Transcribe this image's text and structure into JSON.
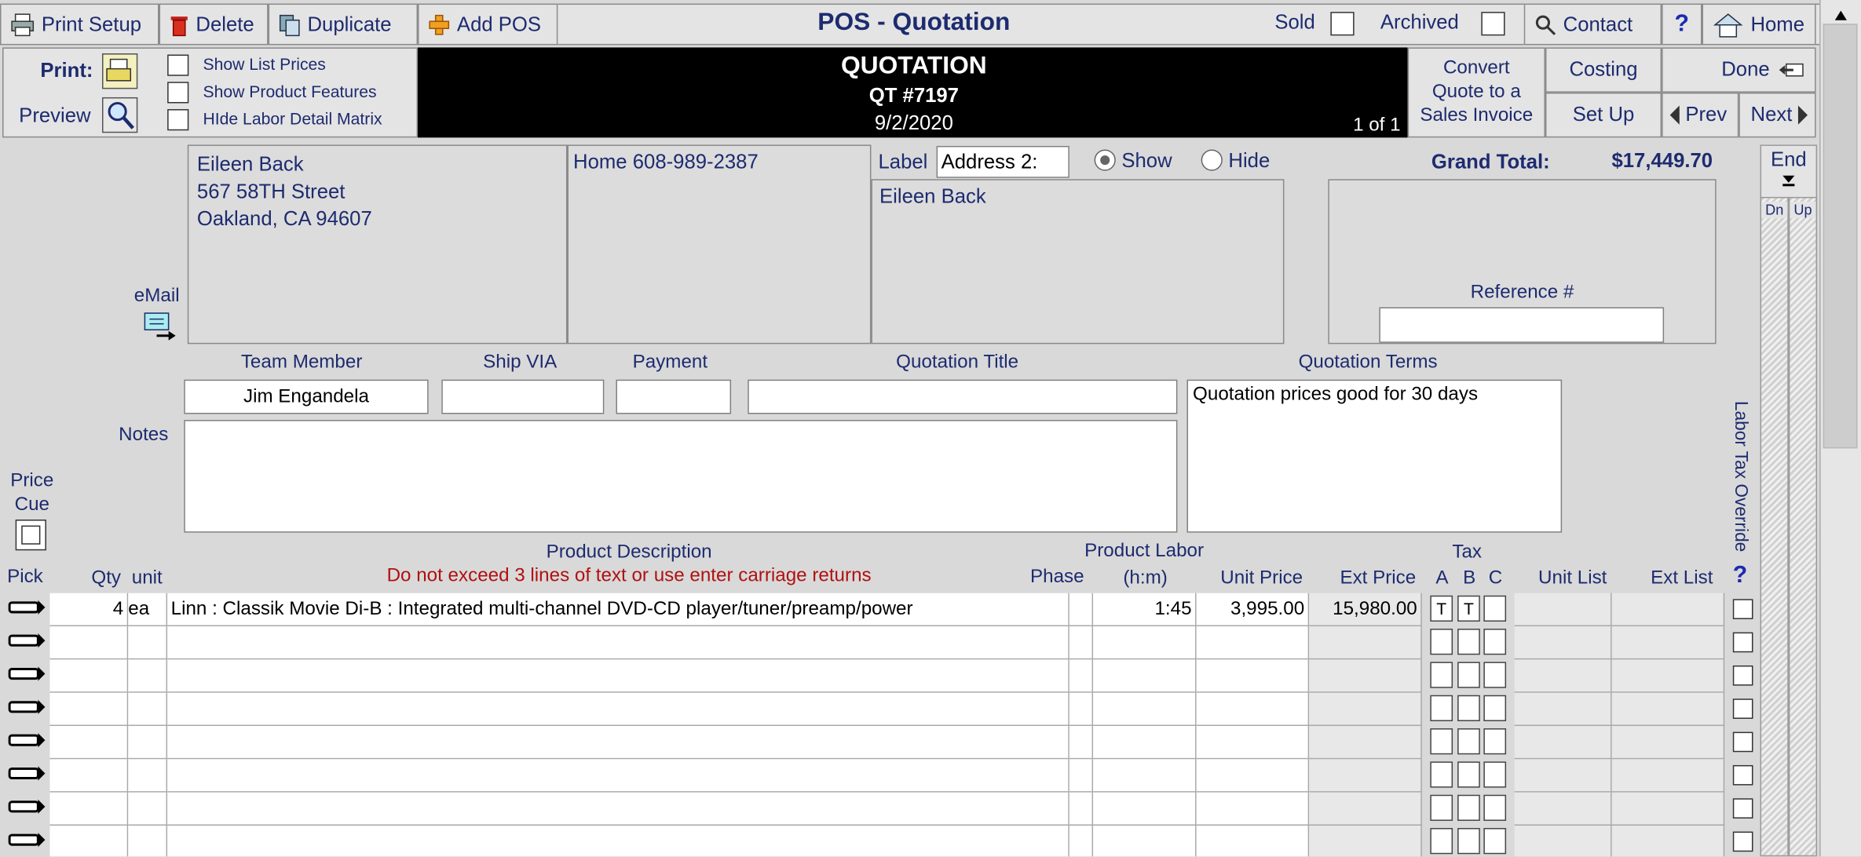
{
  "toolbar": {
    "print_setup": "Print Setup",
    "delete": "Delete",
    "duplicate": "Duplicate",
    "add_pos": "Add POS",
    "title": "POS - Quotation",
    "sold": "Sold",
    "archived": "Archived",
    "contact": "Contact",
    "help": "?",
    "home": "Home"
  },
  "print_panel": {
    "print": "Print:",
    "preview": "Preview",
    "options": [
      "Show List Prices",
      "Show Product Features",
      "HIde Labor Detail Matrix"
    ]
  },
  "header": {
    "doc_type": "QUOTATION",
    "number": "QT #7197",
    "date": "9/2/2020",
    "page": "1 of 1"
  },
  "actions": {
    "convert": "Convert Quote to a Sales Invoice",
    "costing": "Costing",
    "done": "Done",
    "setup": "Set Up",
    "prev": "Prev",
    "next": "Next"
  },
  "scroll": {
    "end": "End",
    "dn": "Dn",
    "up": "Up"
  },
  "customer": {
    "name": "Eileen Back",
    "street": "567 58TH Street",
    "city": "Oakland, CA 94607",
    "phone": "Home 608-989-2387",
    "email_label": "eMail"
  },
  "address2": {
    "label": "Label",
    "value": "Address 2:",
    "show": "Show",
    "hide": "Hide",
    "name": "Eileen Back"
  },
  "totals": {
    "grand_total_label": "Grand Total:",
    "grand_total": "$17,449.70",
    "reference_label": "Reference #",
    "reference": ""
  },
  "fields": {
    "team_member_label": "Team Member",
    "team_member": "Jim Engandela",
    "ship_via_label": "Ship VIA",
    "ship_via": "",
    "payment_label": "Payment",
    "payment": "",
    "title_label": "Quotation Title",
    "title": "",
    "terms_label": "Quotation Terms",
    "terms": "Quotation prices good for 30 days",
    "notes_label": "Notes",
    "notes": "",
    "price_cue": "Price Cue"
  },
  "columns": {
    "pick": "Pick",
    "qty": "Qty",
    "unit": "unit",
    "desc": "Product Description",
    "desc_warning": "Do not exceed 3 lines of text or use enter carriage returns",
    "phase": "Phase",
    "labor_top": "Product Labor",
    "labor_bottom": "(h:m)",
    "unit_price": "Unit Price",
    "ext_price": "Ext Price",
    "tax": "Tax",
    "tax_a": "A",
    "tax_b": "B",
    "tax_c": "C",
    "unit_list": "Unit List",
    "ext_list": "Ext List",
    "labor_tax_override": "Labor Tax Override",
    "labor_tax_help": "?"
  },
  "line_items": [
    {
      "qty": "4",
      "unit": "ea",
      "description": "Linn : Classik Movie Di-B : Integrated multi-channel DVD-CD player/tuner/preamp/power",
      "phase": "",
      "labor": "1:45",
      "unit_price": "3,995.00",
      "ext_price": "15,980.00",
      "tax_a": "T",
      "tax_b": "T",
      "tax_c": "",
      "unit_list": "",
      "ext_list": ""
    },
    {
      "qty": "",
      "unit": "",
      "description": "",
      "phase": "",
      "labor": "",
      "unit_price": "",
      "ext_price": "",
      "tax_a": "",
      "tax_b": "",
      "tax_c": "",
      "unit_list": "",
      "ext_list": ""
    },
    {
      "qty": "",
      "unit": "",
      "description": "",
      "phase": "",
      "labor": "",
      "unit_price": "",
      "ext_price": "",
      "tax_a": "",
      "tax_b": "",
      "tax_c": "",
      "unit_list": "",
      "ext_list": ""
    },
    {
      "qty": "",
      "unit": "",
      "description": "",
      "phase": "",
      "labor": "",
      "unit_price": "",
      "ext_price": "",
      "tax_a": "",
      "tax_b": "",
      "tax_c": "",
      "unit_list": "",
      "ext_list": ""
    },
    {
      "qty": "",
      "unit": "",
      "description": "",
      "phase": "",
      "labor": "",
      "unit_price": "",
      "ext_price": "",
      "tax_a": "",
      "tax_b": "",
      "tax_c": "",
      "unit_list": "",
      "ext_list": ""
    },
    {
      "qty": "",
      "unit": "",
      "description": "",
      "phase": "",
      "labor": "",
      "unit_price": "",
      "ext_price": "",
      "tax_a": "",
      "tax_b": "",
      "tax_c": "",
      "unit_list": "",
      "ext_list": ""
    },
    {
      "qty": "",
      "unit": "",
      "description": "",
      "phase": "",
      "labor": "",
      "unit_price": "",
      "ext_price": "",
      "tax_a": "",
      "tax_b": "",
      "tax_c": "",
      "unit_list": "",
      "ext_list": ""
    },
    {
      "qty": "",
      "unit": "",
      "description": "",
      "phase": "",
      "labor": "",
      "unit_price": "",
      "ext_price": "",
      "tax_a": "",
      "tax_b": "",
      "tax_c": "",
      "unit_list": "",
      "ext_list": ""
    }
  ],
  "colors": {
    "accent": "#1d2b6f",
    "warning": "#b01010",
    "header_bg": "#000000"
  }
}
